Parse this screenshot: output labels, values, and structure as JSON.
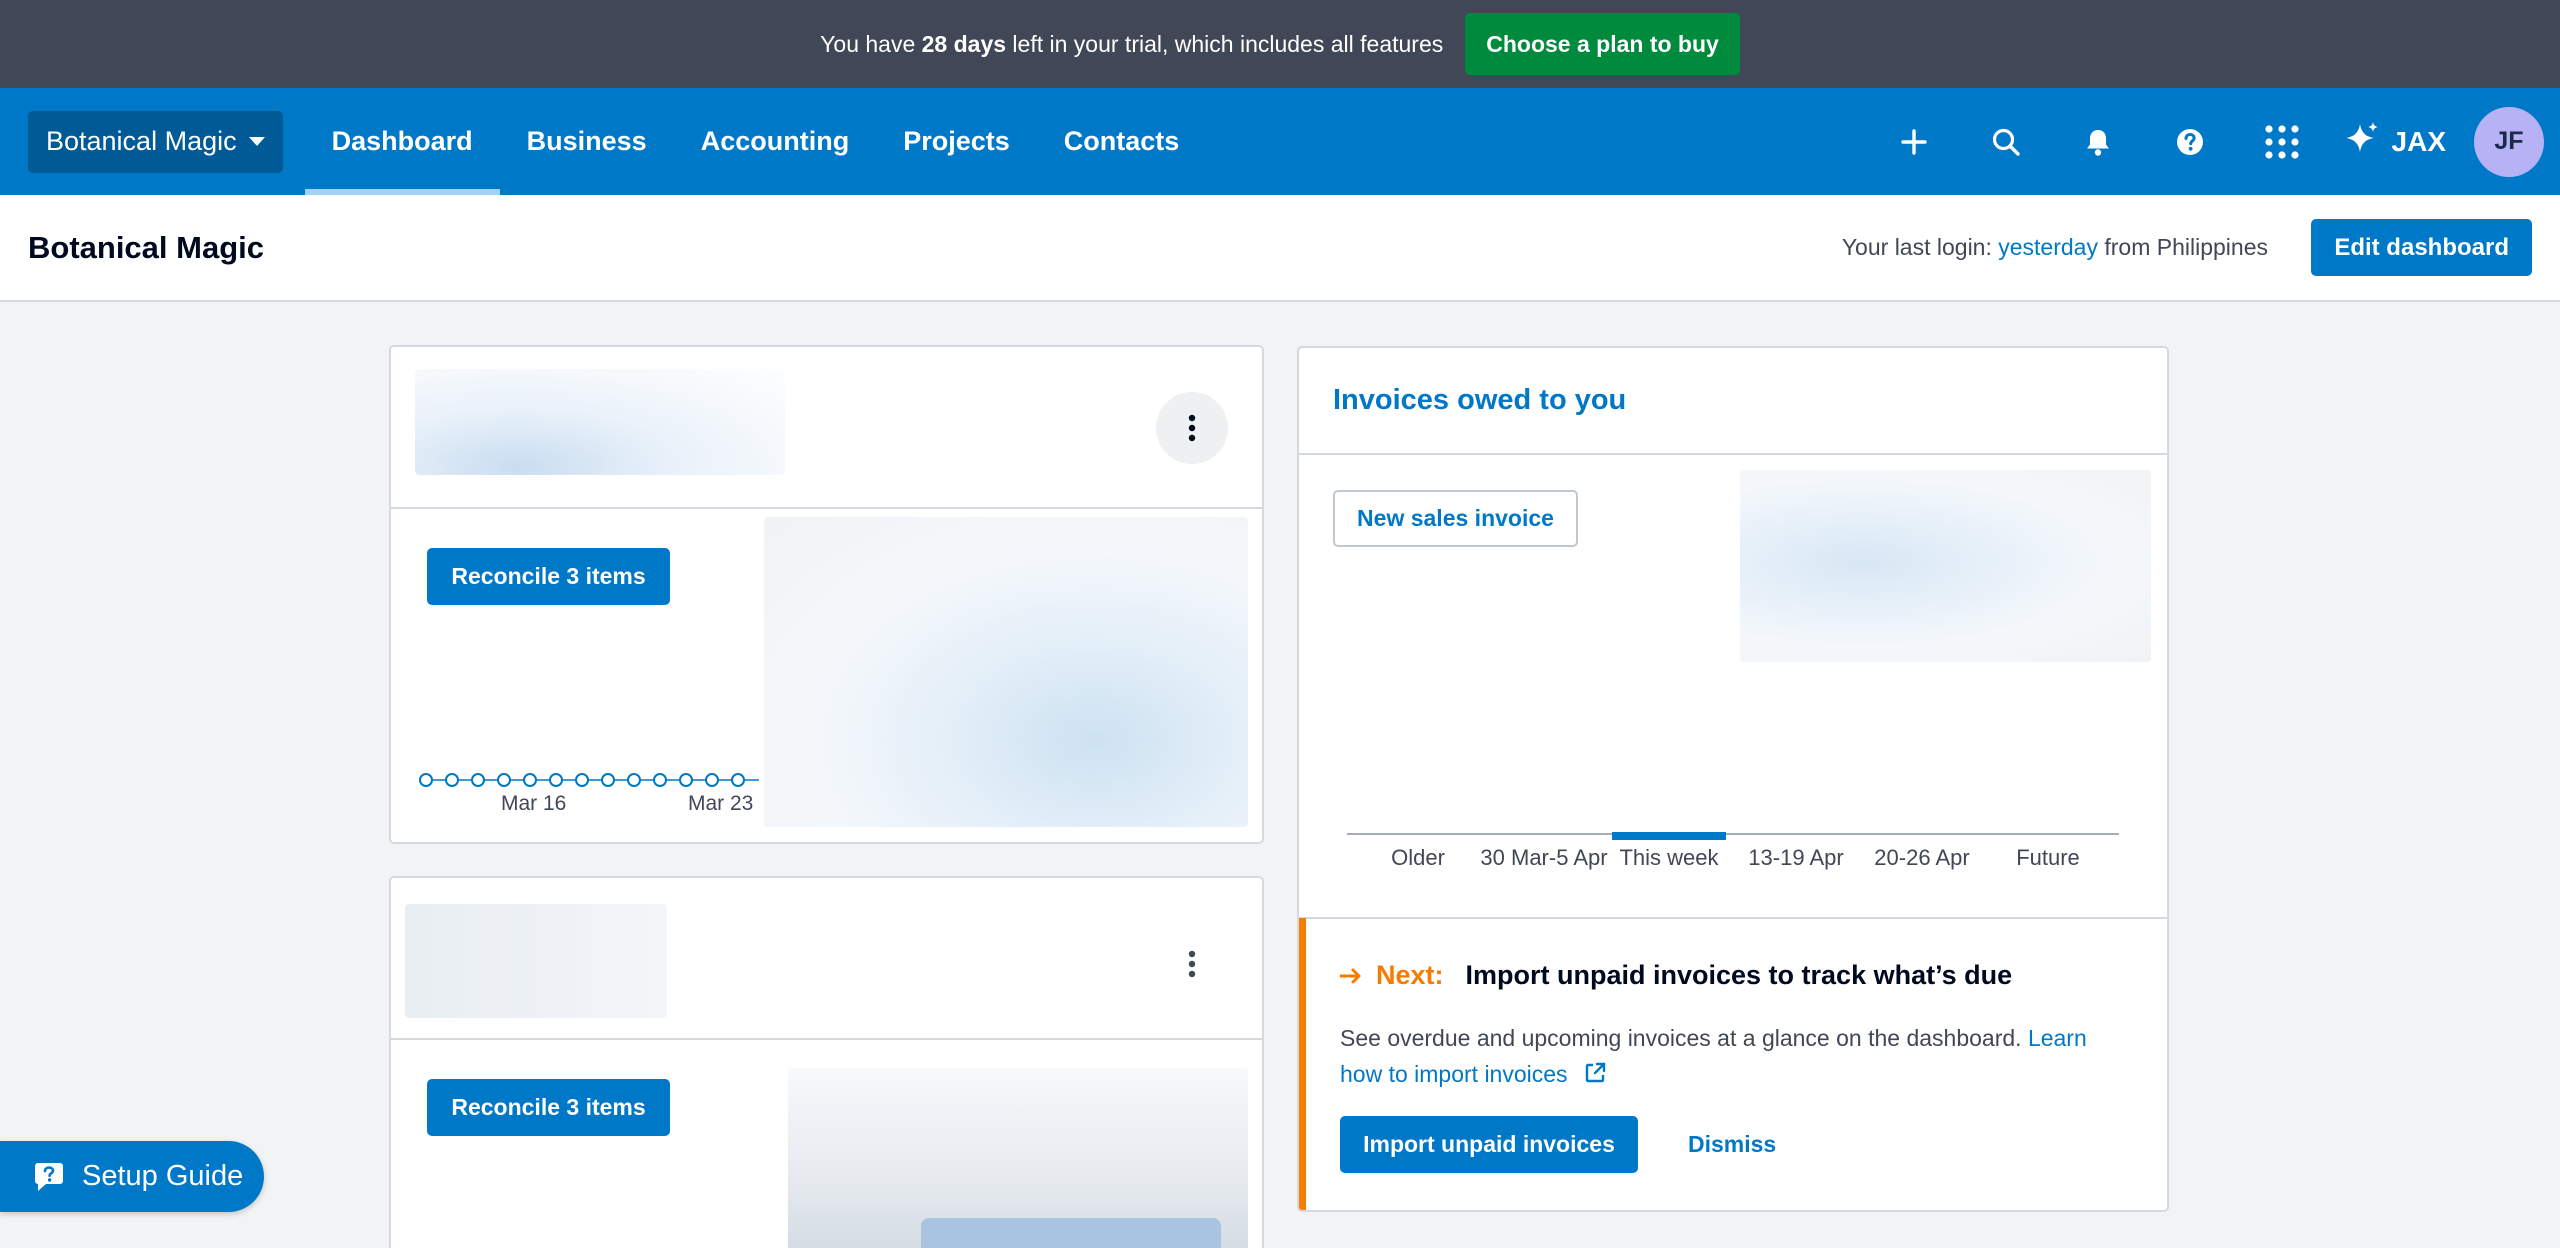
{
  "trial_banner": {
    "text_before": "You have ",
    "days": "28 days",
    "text_after": " left in your trial, which includes all features",
    "buy_button": "Choose a plan to buy"
  },
  "nav": {
    "org_name": "Botanical Magic",
    "tabs": [
      {
        "label": "Dashboard",
        "active": true
      },
      {
        "label": "Business",
        "active": false
      },
      {
        "label": "Accounting",
        "active": false
      },
      {
        "label": "Projects",
        "active": false
      },
      {
        "label": "Contacts",
        "active": false
      }
    ],
    "icons": [
      "plus-icon",
      "search-icon",
      "bell-icon",
      "help-icon",
      "apps-grid-icon",
      "jax-sparkle-icon"
    ],
    "jax_label": "JAX",
    "avatar_initials": "JF"
  },
  "subheader": {
    "title": "Botanical Magic",
    "login_prefix": "Your last login: ",
    "login_when": "yesterday",
    "login_suffix": " from Philippines",
    "edit_button": "Edit dashboard"
  },
  "bank_card_1": {
    "reconcile_button": "Reconcile 3 items",
    "date_labels": [
      "Mar 16",
      "Mar 23"
    ]
  },
  "bank_card_2": {
    "reconcile_button": "Reconcile 3 items"
  },
  "invoices": {
    "title": "Invoices owed to you",
    "new_invoice_button": "New sales invoice",
    "axis": [
      "Older",
      "30 Mar-5 Apr",
      "This week",
      "13-19 Apr",
      "20-26 Apr",
      "Future"
    ],
    "next_label": "Next:",
    "next_heading": "Import unpaid invoices to track what’s due",
    "description": "See overdue and upcoming invoices at a glance on the dashboard. ",
    "learn_link": "Learn how to import invoices",
    "import_button": "Import unpaid invoices",
    "dismiss_button": "Dismiss"
  },
  "setup_guide": {
    "label": "Setup Guide"
  },
  "colors": {
    "brand_blue": "#0078c8",
    "trial_bar": "#404756",
    "buy_green": "#008a3e",
    "next_orange": "#f57c00"
  }
}
